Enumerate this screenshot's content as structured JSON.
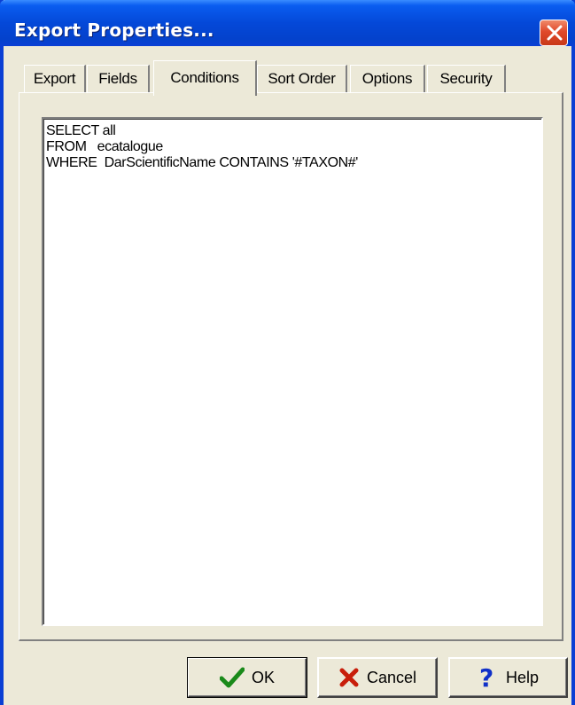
{
  "window": {
    "title": "Export Properties...",
    "close_icon": "close-icon"
  },
  "tabs": [
    {
      "label": "Export",
      "active": false
    },
    {
      "label": "Fields",
      "active": false
    },
    {
      "label": "Conditions",
      "active": true
    },
    {
      "label": "Sort Order",
      "active": false
    },
    {
      "label": "Options",
      "active": false
    },
    {
      "label": "Security",
      "active": false
    }
  ],
  "editor": {
    "lines": [
      "SELECT all",
      "FROM   ecatalogue",
      "WHERE  DarScientificName CONTAINS '#TAXON#'"
    ]
  },
  "buttons": {
    "ok": {
      "label": "OK",
      "icon": "checkmark-icon",
      "color": "#1a8a1a"
    },
    "cancel": {
      "label": "Cancel",
      "icon": "x-icon",
      "color": "#c81e0a"
    },
    "help": {
      "label": "Help",
      "icon": "question-mark-icon",
      "color": "#1030c8"
    }
  }
}
